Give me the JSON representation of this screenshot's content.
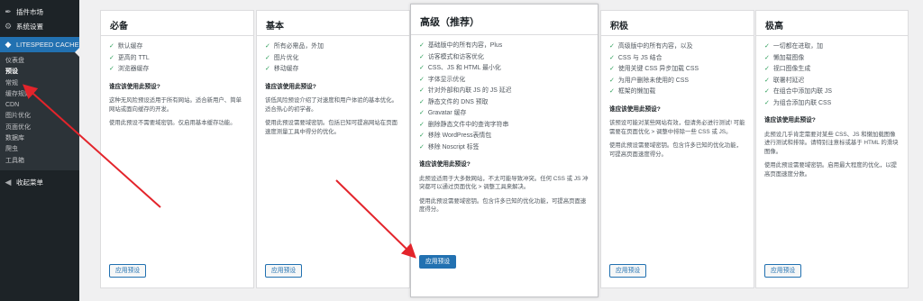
{
  "sidebar": {
    "top_items": [
      {
        "label": "插件市场",
        "icon": "plugin-icon"
      },
      {
        "label": "系统设置",
        "icon": "settings-icon"
      }
    ],
    "active": {
      "label": "LITESPEED CACHE",
      "icon": "diamond-icon"
    },
    "sub_items": [
      "仪表盘",
      "预设",
      "常规",
      "缓存规则",
      "CDN",
      "图片优化",
      "页面优化",
      "数据库",
      "爬虫",
      "工具箱"
    ],
    "current_sub": "预设",
    "collapse": {
      "label": "收起菜单",
      "icon": "collapse-icon"
    }
  },
  "presets": [
    {
      "title": "必备",
      "features": [
        "默认缓存",
        "更高的 TTL",
        "浏览器缓存"
      ],
      "who_title": "谁应该使用此预设?",
      "paras": [
        "这种无风险预设适用于所有网站。适合新用户、简单网站或面向缓存的开发。",
        "使用此预设不需要域密钥。仅启用基本缓存功能。"
      ],
      "button": "应用预设"
    },
    {
      "title": "基本",
      "features": [
        "所有必需品，外加",
        "图片优化",
        "移动缓存"
      ],
      "who_title": "谁应该使用此预设?",
      "paras": [
        "该低风险预设介绍了对速度和用户体验的基本优化。适合热心的初学者。",
        "使用此预设需要域密钥。包括已知可提高网站在页面速度测量工具中得分的优化。"
      ],
      "button": "应用预设"
    },
    {
      "title": "高级（推荐）",
      "features": [
        "基础版中的所有内容，Plus",
        "访客模式和访客优化",
        "CSS、JS 和 HTML 最小化",
        "字体显示优化",
        "针对外部和内联 JS 的 JS 延迟",
        "静态文件的 DNS 预取",
        "Gravatar 缓存",
        "删除静态文件中的查询字符串",
        "移除 WordPress表情包",
        "移除 Noscript 标签"
      ],
      "who_title": "谁应该使用此预设?",
      "paras": [
        "此预设适用于大多数网站，不太可能导致冲突。任何 CSS 或 JS 冲突都可以通过页面优化 > 调整工具来解决。",
        "使用此预设需要域密钥。包含许多已知的优化功能，可提高页面速度得分。"
      ],
      "button": "应用预设"
    },
    {
      "title": "积极",
      "features": [
        "高级版中的所有内容，以及",
        "CSS 与 JS 结合",
        "使用关键 CSS 异步加载 CSS",
        "为用户删除未使用的 CSS",
        "框架的懒加载"
      ],
      "who_title": "谁应该使用此预设?",
      "paras": [
        "该预设可能对某些网站有效，但请务必进行测试! 可能需要在页面优化 > 调整中排除一些 CSS 或 JS。",
        "使用此预设需要域密钥。包含许多已知的优化功能，可提高页面速度得分。"
      ],
      "button": "应用预设"
    },
    {
      "title": "极高",
      "features": [
        "一切都在进取，加",
        "懒加载图像",
        "视口图像生成",
        "联署村延迟",
        "在组合中添加内联 JS",
        "为组合添加内联 CSS"
      ],
      "who_title": "谁应该使用此预设?",
      "paras": [
        "此预设几乎肯定需要对某些 CSS、JS 和懒加载图像进行测试和排除。请特别注意标或基于 HTML 的滑块图像。",
        "使用此预设需要域密钥。启用最大程度的优化，以提高页面速度分数。"
      ],
      "button": "应用预设"
    }
  ],
  "colors": {
    "accent": "#2271b1",
    "arrow": "#e3242b",
    "check": "#2e9e5a"
  }
}
